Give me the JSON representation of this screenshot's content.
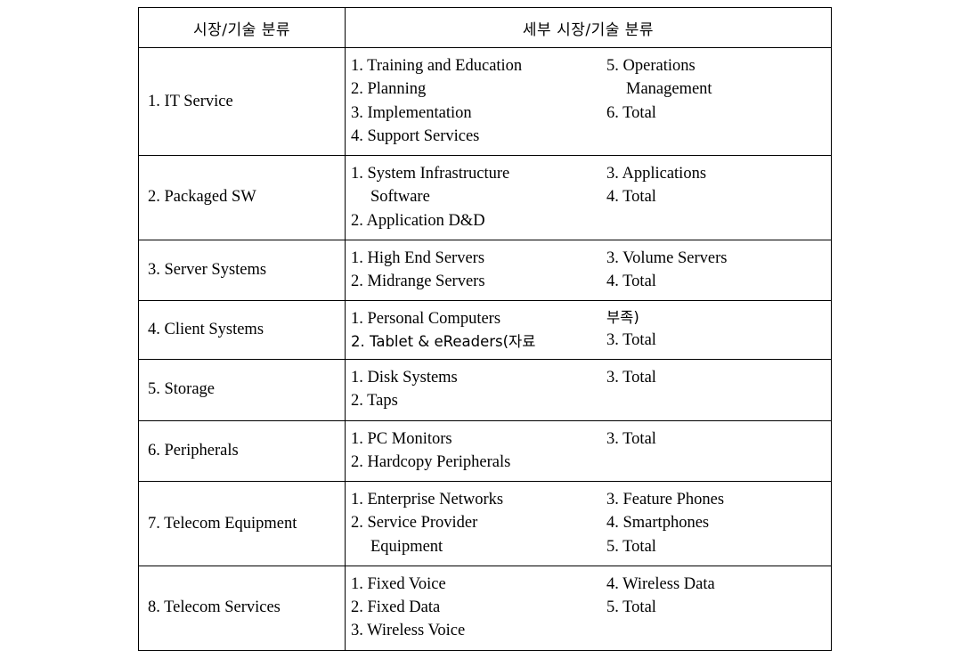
{
  "table": {
    "headers": {
      "major": "시장/기술 분류",
      "detail": "세부 시장/기술 분류"
    },
    "rows": [
      {
        "major": "1. IT Service",
        "left": [
          "1. Training and Education",
          "2. Planning",
          "3. Implementation",
          "4. Support Services"
        ],
        "right": [
          "5. Operations",
          "Management",
          "6. Total"
        ],
        "right_cont": [
          false,
          true,
          false
        ]
      },
      {
        "major": "2. Packaged SW",
        "left": [
          "1. System Infrastructure",
          "Software",
          "2. Application D&D"
        ],
        "left_cont": [
          false,
          true,
          false
        ],
        "right": [
          "3. Applications",
          "4. Total"
        ],
        "right_cont": [
          false,
          false
        ]
      },
      {
        "major": "3. Server Systems",
        "left": [
          "1. High End Servers",
          "2. Midrange Servers"
        ],
        "left_cont": [
          false,
          false
        ],
        "right": [
          "3. Volume Servers",
          "4. Total"
        ],
        "right_cont": [
          false,
          false
        ]
      },
      {
        "major": "4. Client Systems",
        "left": [
          "1. Personal Computers",
          "2. Tablet & eReaders(자료"
        ],
        "left_cont": [
          false,
          false
        ],
        "right": [
          "부족)",
          "3. Total"
        ],
        "right_cont": [
          false,
          false
        ]
      },
      {
        "major": "5. Storage",
        "left": [
          "1. Disk Systems",
          "2. Taps"
        ],
        "left_cont": [
          false,
          false
        ],
        "right": [
          "3. Total"
        ],
        "right_cont": [
          false
        ]
      },
      {
        "major": "6. Peripherals",
        "left": [
          "1. PC Monitors",
          "2. Hardcopy Peripherals"
        ],
        "left_cont": [
          false,
          false
        ],
        "right": [
          "3. Total"
        ],
        "right_cont": [
          false
        ]
      },
      {
        "major": "7. Telecom Equipment",
        "left": [
          "1. Enterprise Networks",
          "2. Service Provider",
          "Equipment"
        ],
        "left_cont": [
          false,
          false,
          true
        ],
        "right": [
          "3. Feature Phones",
          "4. Smartphones",
          "5. Total"
        ],
        "right_cont": [
          false,
          false,
          false
        ]
      },
      {
        "major": "8. Telecom Services",
        "left": [
          "1. Fixed Voice",
          "2. Fixed Data",
          "3. Wireless Voice"
        ],
        "left_cont": [
          false,
          false,
          false
        ],
        "right": [
          "4. Wireless Data",
          "5. Total"
        ],
        "right_cont": [
          false,
          false
        ]
      }
    ]
  }
}
